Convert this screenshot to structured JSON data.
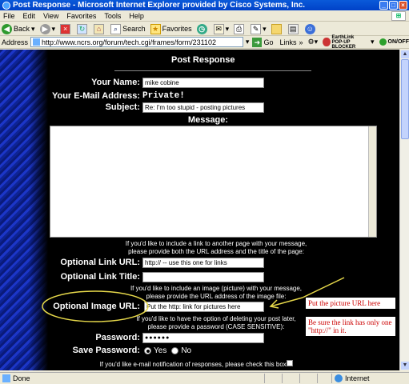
{
  "window": {
    "title": "Post Response - Microsoft Internet Explorer provided by Cisco Systems, Inc."
  },
  "menu": [
    "File",
    "Edit",
    "View",
    "Favorites",
    "Tools",
    "Help"
  ],
  "toolbar": {
    "back": "Back",
    "search": "Search",
    "favorites": "Favorites"
  },
  "address": {
    "label": "Address",
    "url": "http://www.ncrs.org/forum/tech.cgi/frames/form/231102",
    "go": "Go",
    "links": "Links",
    "earthlink_line1": "EarthLink",
    "earthlink_line2": "POP-UP BLOCKER",
    "onoff": "ON/OFF"
  },
  "form": {
    "heading": "Post Response",
    "name_label": "Your Name:",
    "name_value": "mike cobine",
    "email_label": "Your E-Mail Address:",
    "email_value": "Private!",
    "subject_label": "Subject:",
    "subject_value": "Re: I'm too stupid - posting pictures",
    "message_label": "Message:",
    "link_note_1": "If you'd like to include a link to another page with your message,",
    "link_note_2": "please provide both the URL address and the title of the page:",
    "link_url_label": "Optional Link URL:",
    "link_url_value": "http:// -- use this one for links",
    "link_title_label": "Optional Link Title:",
    "link_title_value": "",
    "image_note_1": "If you'd like to include an image (picture) with your message,",
    "image_note_2": "please provide the URL address of the image file:",
    "image_url_label": "Optional Image URL:",
    "image_url_value": "Put the http: link for pictures here",
    "password_note_1": "If you'd like to have the option of deleting your post later,",
    "password_note_2": "please provide a password (CASE SENSITIVE):",
    "password_label": "Password:",
    "password_value": "●●●●●●",
    "save_password_label": "Save Password:",
    "yes": "Yes",
    "no": "No",
    "notify_note": "If you'd like e-mail notification of responses, please check this box:"
  },
  "annotations": {
    "note1": "Put the picture URL here",
    "note2": "Be sure the link has only one \"http://\" in it."
  },
  "status": {
    "left": "Done",
    "zone": "Internet"
  },
  "colors": {
    "page_bg": "#000000",
    "annotation": "#cc0000",
    "oval": "#e6d84a"
  }
}
